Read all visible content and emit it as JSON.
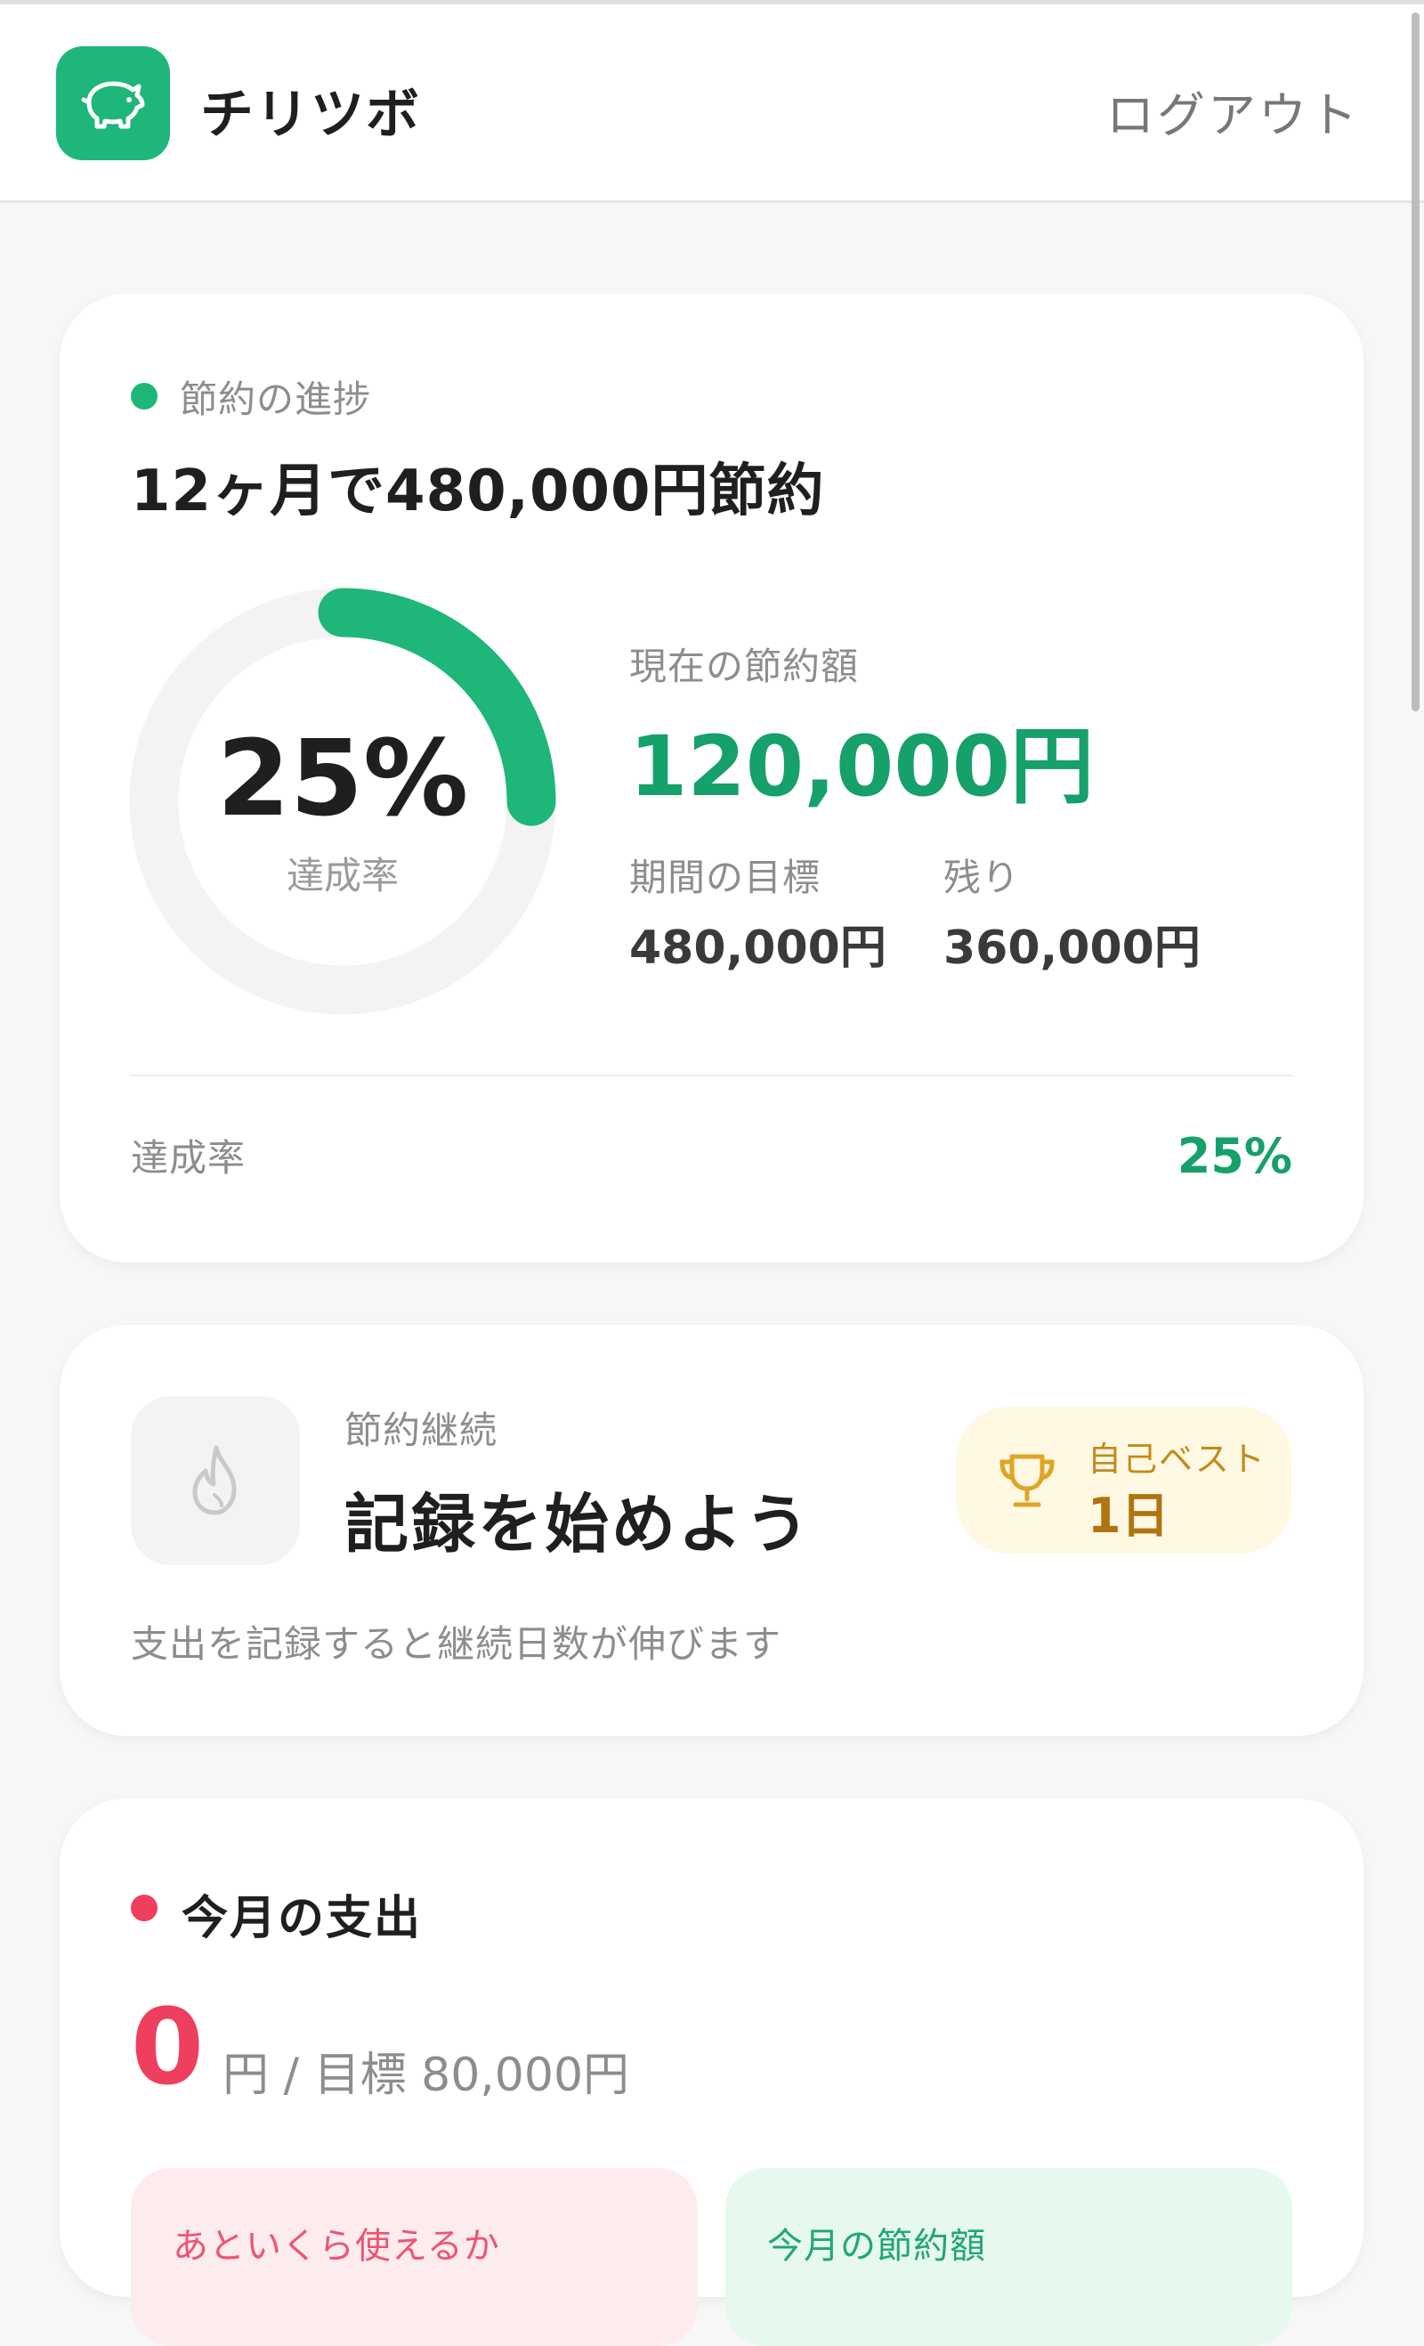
{
  "app": {
    "name": "チリツボ",
    "logout_label": "ログアウト",
    "logo_icon": "piggy-bank-icon"
  },
  "progress": {
    "section_label": "節約の進捗",
    "title": "12ヶ月で480,000円節約",
    "ring_percent": 25,
    "percent_label": "25%",
    "percent_caption": "達成率",
    "current_label": "現在の節約額",
    "current_value": "120,000円",
    "target_label": "期間の目標",
    "target_value": "480,000円",
    "remaining_label": "残り",
    "remaining_value": "360,000円",
    "footer_label": "達成率",
    "footer_value": "25%",
    "accent_color": "#1fb67a"
  },
  "streak": {
    "icon": "flame-icon",
    "label": "節約継続",
    "title": "記録を始めよう",
    "best_label": "自己ベスト",
    "best_value": "1日",
    "best_icon": "trophy-icon",
    "description": "支出を記録すると継続日数が伸びます"
  },
  "spending": {
    "title": "今月の支出",
    "value": "0",
    "target_text": "円 / 目標 80,000円",
    "accent_color": "#ee3f5e",
    "tiles": [
      {
        "label": "あといくら使えるか"
      },
      {
        "label": "今月の節約額"
      }
    ]
  }
}
